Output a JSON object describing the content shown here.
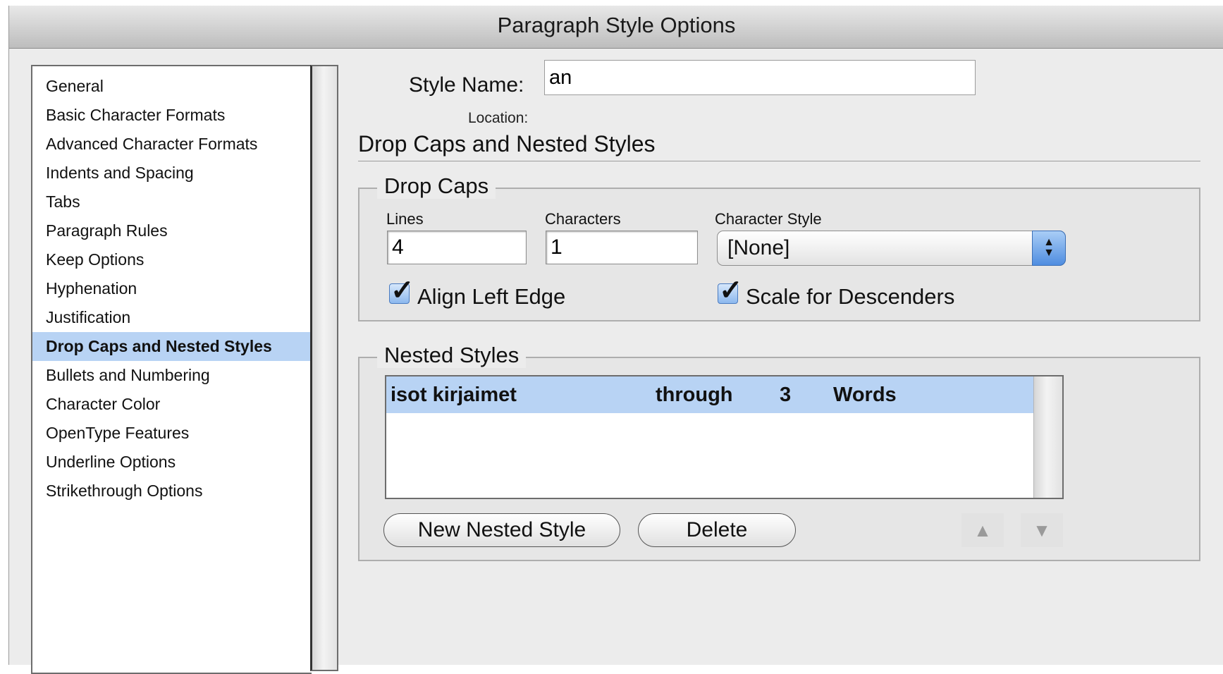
{
  "window": {
    "title": "Paragraph Style Options"
  },
  "sidebar": {
    "items": [
      {
        "label": "General"
      },
      {
        "label": "Basic Character Formats"
      },
      {
        "label": "Advanced Character Formats"
      },
      {
        "label": "Indents and Spacing"
      },
      {
        "label": "Tabs"
      },
      {
        "label": "Paragraph Rules"
      },
      {
        "label": "Keep Options"
      },
      {
        "label": "Hyphenation"
      },
      {
        "label": "Justification"
      },
      {
        "label": "Drop Caps and Nested Styles",
        "selected": true
      },
      {
        "label": "Bullets and Numbering"
      },
      {
        "label": "Character Color"
      },
      {
        "label": "OpenType Features"
      },
      {
        "label": "Underline Options"
      },
      {
        "label": "Strikethrough Options"
      }
    ]
  },
  "style_name": {
    "label": "Style Name:",
    "value": "an"
  },
  "location": {
    "label": "Location:"
  },
  "section": {
    "title": "Drop Caps and Nested Styles"
  },
  "drop_caps": {
    "legend": "Drop Caps",
    "lines_label": "Lines",
    "lines_value": "4",
    "characters_label": "Characters",
    "characters_value": "1",
    "character_style_label": "Character Style",
    "character_style_value": "[None]",
    "align_left_edge": {
      "label": "Align Left Edge",
      "checked": true
    },
    "scale_for_descenders": {
      "label": "Scale for Descenders",
      "checked": true
    }
  },
  "nested_styles": {
    "legend": "Nested Styles",
    "rows": [
      {
        "style": "isot kirjaimet",
        "mode": "through",
        "count": "3",
        "unit": "Words"
      }
    ],
    "new_button": "New Nested Style",
    "delete_button": "Delete",
    "move_up_icon": "triangle-up-icon",
    "move_down_icon": "triangle-down-icon"
  },
  "colors": {
    "selection": "#b8d3f4",
    "window_bg": "#ececec",
    "aqua_accent": "#4f8de0"
  }
}
